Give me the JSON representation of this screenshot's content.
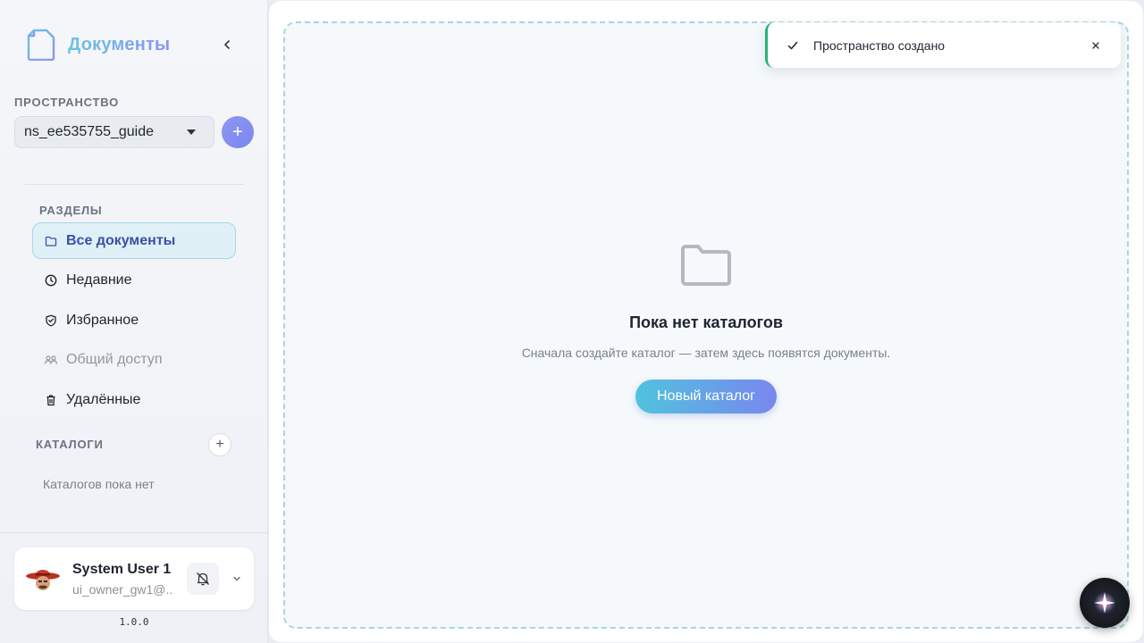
{
  "app": {
    "title": "Документы"
  },
  "sidebar": {
    "space_label": "ПРОСТРАНСТВО",
    "space_selected": "ns_ee535755_guide",
    "add_space_label": "+",
    "sections_label": "РАЗДЕЛЫ",
    "nav": [
      {
        "label": "Все документы",
        "icon": "folder-icon",
        "active": true
      },
      {
        "label": "Недавние",
        "icon": "clock-icon"
      },
      {
        "label": "Избранное",
        "icon": "shield-icon"
      },
      {
        "label": "Общий доступ",
        "icon": "users-icon",
        "muted": true
      },
      {
        "label": "Удалённые",
        "icon": "trash-icon"
      }
    ],
    "catalogs_label": "КАТАЛОГИ",
    "add_catalog_label": "+",
    "no_catalogs": "Каталогов пока нет"
  },
  "user": {
    "name": "System User 1",
    "email": "ui_owner_gw1@...",
    "version": "1.0.0"
  },
  "main": {
    "empty_title": "Пока нет каталогов",
    "empty_subtitle": "Сначала создайте каталог — затем здесь появятся документы.",
    "new_catalog_button": "Новый каталог"
  },
  "toast": {
    "message": "Пространство создано",
    "status_color": "#26b27a"
  },
  "colors": {
    "accent": "#7b86ee",
    "accent_cyan": "#4fc3dd",
    "active_bg": "#dff0f6"
  }
}
